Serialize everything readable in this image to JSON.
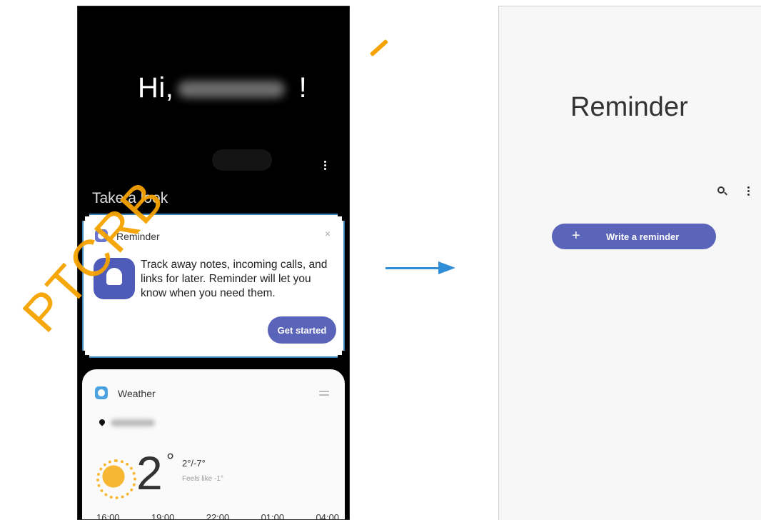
{
  "left_screen": {
    "greeting_prefix": "Hi,",
    "greeting_suffix": "!",
    "section_title": "Take a look",
    "reminder_card": {
      "title": "Reminder",
      "close_glyph": "×",
      "description": "Track away notes, incoming calls, and links for later. Reminder will let you know when you need them.",
      "button_label": "Get started"
    },
    "weather_card": {
      "title": "Weather",
      "temperature": "2",
      "degree_symbol": "°",
      "high_low": "2°/-7°",
      "feels_like": "Feels like -1°",
      "hours": [
        "16:00",
        "19:00",
        "22:00",
        "01:00",
        "04:00"
      ]
    }
  },
  "watermark": "PTCRB",
  "right_screen": {
    "title": "Reminder",
    "write_button_plus": "+",
    "write_button_label": "Write a reminder"
  },
  "colors": {
    "accent_button": "#5a64b8",
    "arrow": "#2f8ed6",
    "watermark": "#f5a300",
    "highlight_border": "#3b82b4"
  },
  "icons": [
    "more-vertical-icon",
    "reminder-app-icon",
    "weather-app-icon",
    "location-pin-icon",
    "sun-icon",
    "search-icon",
    "arrow-right-icon"
  ]
}
